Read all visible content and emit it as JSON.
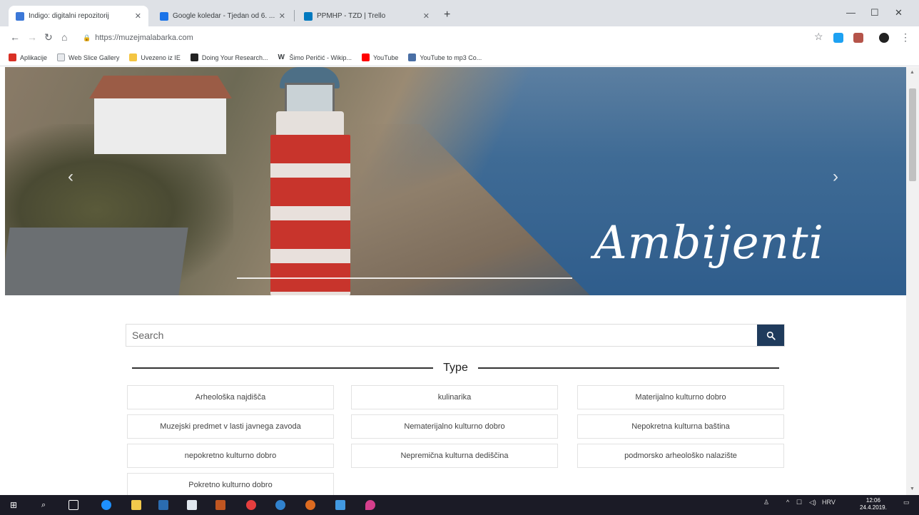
{
  "browser": {
    "tabs": [
      {
        "title": "Indigo: digitalni repozitorij",
        "fav_color": "#3c78d8"
      },
      {
        "title": "Google koledar - Tjedan od 6. ...",
        "fav_color": "#1a73e8"
      },
      {
        "title": "PPMHP - TZD | Trello",
        "fav_color": "#0079bf"
      }
    ],
    "url": "https://muzejmalabarka.com",
    "bookmarks": [
      {
        "label": "Aplikacije",
        "color": "#d93025"
      },
      {
        "label": "Web Slice Gallery",
        "color": "#9aa0a6"
      },
      {
        "label": "Uvezeno iz IE",
        "color": "#f4c542"
      },
      {
        "label": "Doing Your Research...",
        "color": "#222222"
      },
      {
        "label": "Šimo Peričić - Wikip...",
        "color": "#333333"
      },
      {
        "label": "YouTube",
        "color": "#ff0000"
      },
      {
        "label": "YouTube to mp3 Co...",
        "color": "#4a6fa5"
      }
    ]
  },
  "hero": {
    "caption": "Ambijenti",
    "prev_icon": "chevron-left-icon",
    "next_icon": "chevron-right-icon"
  },
  "search": {
    "placeholder": "Search",
    "button_icon": "search-icon",
    "button_color": "#1f3b5c"
  },
  "type_section": {
    "heading": "Type",
    "items": [
      "Arheološka najdišča",
      "kulinarika",
      "Materijalno kulturno dobro",
      "Muzejski predmet v lasti javnega zavoda",
      "Nematerijalno kulturno dobro",
      "Nepokretna kulturna baština",
      "nepokretno kulturno dobro",
      "Nepremična kulturna dediščina",
      "podmorsko arheološko nalazište",
      "Pokretno kulturno dobro"
    ]
  },
  "taskbar": {
    "language": "HRV",
    "time": "12:06",
    "date": "24.4.2019."
  }
}
